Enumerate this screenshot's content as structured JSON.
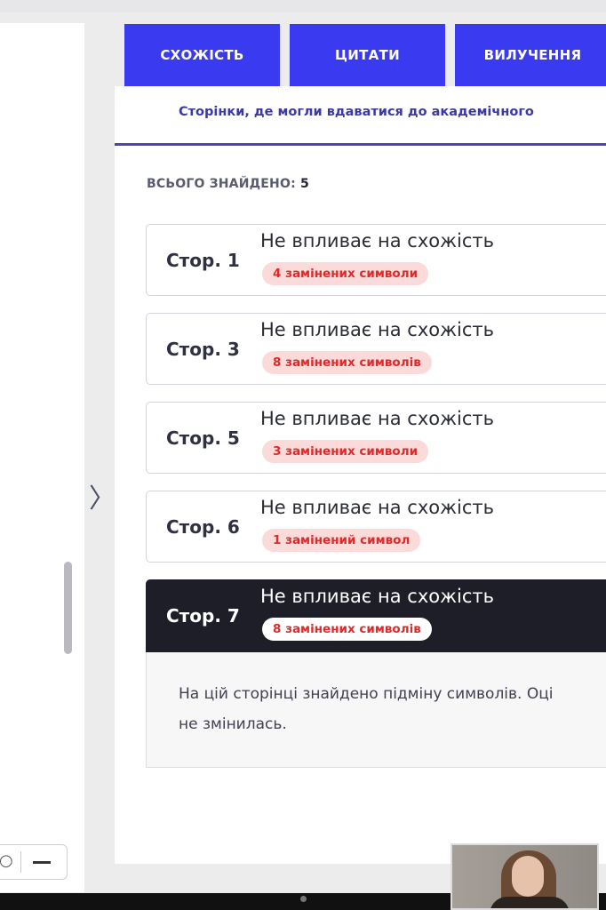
{
  "tabs": [
    {
      "label": "СХОЖІСТЬ"
    },
    {
      "label": "ЦИТАТИ"
    },
    {
      "label": "ВИЛУЧЕННЯ"
    }
  ],
  "subtitle": "Сторінки, де могли вдаватися до академічного",
  "summary": {
    "label": "ВСЬОГО ЗНАЙДЕНО:",
    "count": "5"
  },
  "pages": [
    {
      "page": "Стор. 1",
      "status": "Не впливає на схожість",
      "badge": "4 замінених символи"
    },
    {
      "page": "Стор. 3",
      "status": "Не впливає на схожість",
      "badge": "8 замінених символів"
    },
    {
      "page": "Стор. 5",
      "status": "Не впливає на схожість",
      "badge": "3 замінених символи"
    },
    {
      "page": "Стор. 6",
      "status": "Не впливає на схожість",
      "badge": "1 замінений символ"
    },
    {
      "page": "Стор. 7",
      "status": "Не впливає на схожість",
      "badge": "8 замінених символів"
    }
  ],
  "detail": {
    "line1": "На цій сторінці знайдено підміну символів. Оці",
    "line2": "не змінилась."
  },
  "icons": {
    "collapse_toggle": "chevron-right-icon",
    "zoom_out": "minus-icon",
    "zoom_reset": "circle-icon"
  },
  "colors": {
    "tab_accent": "#3a3af0",
    "badge_text": "#e02a2a",
    "badge_bg": "#fbdada",
    "active_card": "#1d1e28",
    "subtitle": "#3a3aa6"
  }
}
